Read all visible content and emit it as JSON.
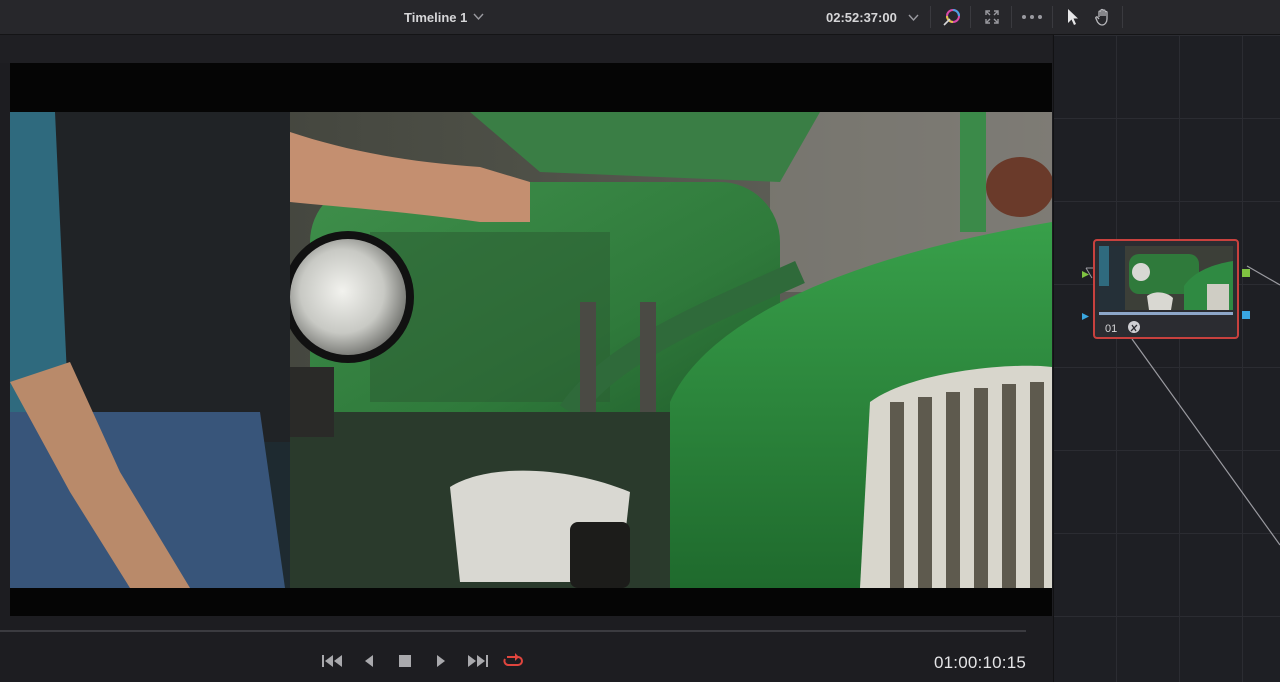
{
  "header": {
    "timeline_title": "Timeline 1",
    "record_timecode": "02:52:37:00"
  },
  "toolbar_icons": [
    "color-wand-icon",
    "expand-icon",
    "more-options-icon",
    "pointer-icon",
    "hand-icon"
  ],
  "viewer": {
    "subject": "green tractor with headlight and hand on hood"
  },
  "transport": {
    "buttons": [
      "jump-to-start-icon",
      "step-back-icon",
      "stop-icon",
      "play-icon",
      "jump-to-end-icon",
      "loop-icon"
    ],
    "loop_color": "#e0453e"
  },
  "playhead_timecode": "01:00:10:15",
  "node_editor": {
    "node_label": "01",
    "node_border_color": "#c8413e"
  }
}
